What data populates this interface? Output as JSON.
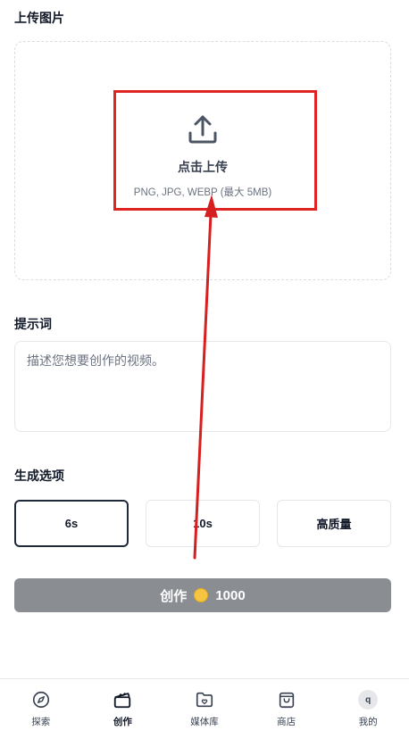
{
  "upload": {
    "section_label": "上传图片",
    "title": "点击上传",
    "hint": "PNG, JPG, WEBP (最大 5MB)"
  },
  "prompt": {
    "section_label": "提示词",
    "placeholder": "描述您想要创作的视频。"
  },
  "options": {
    "section_label": "生成选项",
    "items": [
      {
        "label": "6s",
        "selected": true
      },
      {
        "label": "10s",
        "selected": false
      },
      {
        "label": "高质量",
        "selected": false
      }
    ]
  },
  "create": {
    "label": "创作",
    "cost": "1000",
    "coin_icon": "coin-icon"
  },
  "nav": {
    "items": [
      {
        "label": "探索",
        "icon": "compass-icon"
      },
      {
        "label": "创作",
        "icon": "clapperboard-icon",
        "active": true
      },
      {
        "label": "媒体库",
        "icon": "folder-heart-icon"
      },
      {
        "label": "商店",
        "icon": "shopping-bag-icon"
      },
      {
        "label": "我的",
        "icon": "avatar",
        "avatar_letter": "q"
      }
    ]
  },
  "colors": {
    "annotation_red": "#e02424",
    "create_button_bg": "#8a8d92",
    "coin": "#f5c542"
  }
}
